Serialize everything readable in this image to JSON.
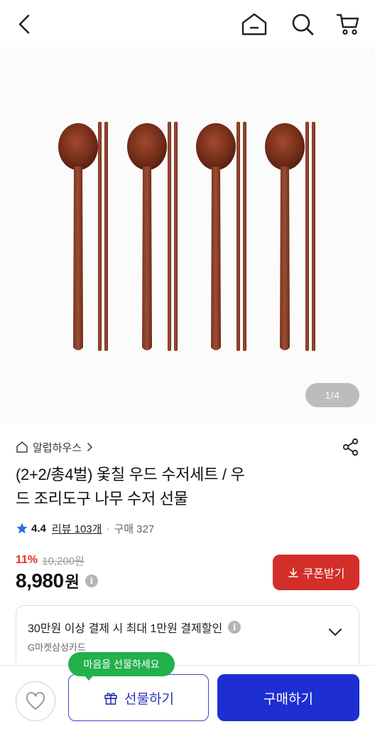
{
  "header": {
    "back_icon": "chevron-left-icon",
    "home_icon": "home-icon",
    "search_icon": "search-icon",
    "cart_icon": "cart-icon"
  },
  "gallery": {
    "current": "1",
    "total": "4",
    "pager_text": "1/4"
  },
  "seller": {
    "name": "알럽하우스",
    "icon": "home-outline-icon"
  },
  "product": {
    "title_line1": "(2+2/총4벌) 옻칠 우드 수저세트 / 우",
    "title_line2": "드 조리도구 나무 수저 선물"
  },
  "rating": {
    "score": "4.4",
    "reviews": "리뷰 103개",
    "sales": "구매 327",
    "star_color": "#2f6fe4"
  },
  "price": {
    "discount_rate": "11%",
    "original": "10,200원",
    "current": "8,980",
    "unit": "원",
    "info": "i"
  },
  "coupon": {
    "label": "쿠폰받기",
    "color": "#d32e2a"
  },
  "card_promo": {
    "text": "30만원 이상 결제 시 최대 1만원 결제할인",
    "card_name": "G마켓삼성카드",
    "info": "i"
  },
  "bottom_bar": {
    "gift_tooltip": "마음을 선물하세요",
    "gift_label": "선물하기",
    "buy_label": "구매하기",
    "tooltip_color": "#22b14c",
    "buy_color": "#1d2fd1"
  }
}
